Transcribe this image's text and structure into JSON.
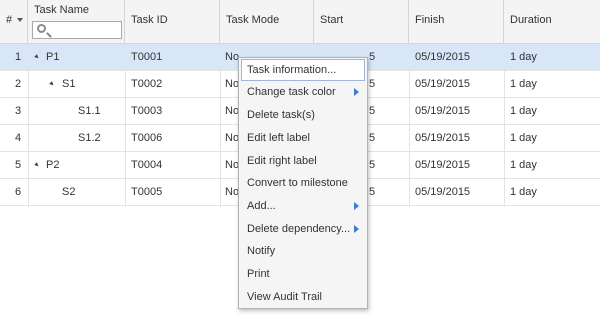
{
  "columns": {
    "number": "#",
    "task_name": "Task Name",
    "task_id": "Task ID",
    "task_mode": "Task Mode",
    "start": "Start",
    "finish": "Finish",
    "duration": "Duration"
  },
  "rows": [
    {
      "num": "1",
      "name": "P1",
      "id": "T0001",
      "mode": "No",
      "start": "5",
      "finish": "05/19/2015",
      "duration": "1 day"
    },
    {
      "num": "2",
      "name": "S1",
      "id": "T0002",
      "mode": "No",
      "start": "5",
      "finish": "05/19/2015",
      "duration": "1 day"
    },
    {
      "num": "3",
      "name": "S1.1",
      "id": "T0003",
      "mode": "No",
      "start": "5",
      "finish": "05/19/2015",
      "duration": "1 day"
    },
    {
      "num": "4",
      "name": "S1.2",
      "id": "T0006",
      "mode": "No",
      "start": "5",
      "finish": "05/19/2015",
      "duration": "1 day"
    },
    {
      "num": "5",
      "name": "P2",
      "id": "T0004",
      "mode": "No",
      "start": "5",
      "finish": "05/19/2015",
      "duration": "1 day"
    },
    {
      "num": "6",
      "name": "S2",
      "id": "T0005",
      "mode": "No",
      "start": "5",
      "finish": "05/19/2015",
      "duration": "1 day"
    }
  ],
  "context_menu": [
    {
      "label": "Task information...",
      "submenu": false
    },
    {
      "label": "Change task color",
      "submenu": true
    },
    {
      "label": "Delete task(s)",
      "submenu": false
    },
    {
      "label": "Edit left label",
      "submenu": false
    },
    {
      "label": "Edit right label",
      "submenu": false
    },
    {
      "label": "Convert to milestone",
      "submenu": false
    },
    {
      "label": "Add...",
      "submenu": true
    },
    {
      "label": "Delete dependency...",
      "submenu": true
    },
    {
      "label": "Notify",
      "submenu": false
    },
    {
      "label": "Print",
      "submenu": false
    },
    {
      "label": "View Audit Trail",
      "submenu": false
    }
  ],
  "icons": {
    "sort": "sort-desc-icon",
    "search": "search-icon",
    "expand": "expand-triangle-icon",
    "submenu": "submenu-arrow-icon"
  },
  "colors": {
    "selected_row": "#d8e6f7",
    "header_bg": "#f4f4f4",
    "menu_bg": "#f5f5f5",
    "submenu_arrow": "#3b7bd4"
  }
}
